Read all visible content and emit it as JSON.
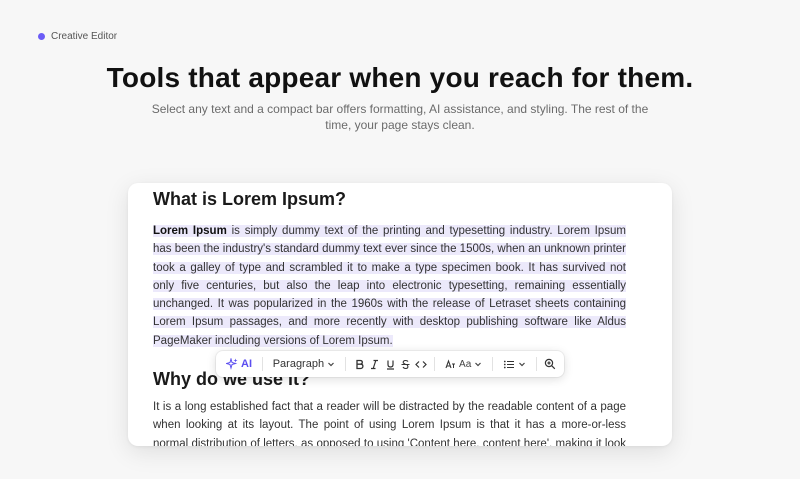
{
  "brand": {
    "label": "Creative Editor",
    "accent": "#6b5cf6"
  },
  "hero": {
    "title": "Tools that appear when you reach for them.",
    "subtitle": "Select any text and a compact bar offers formatting, AI assistance, and styling. The rest of the time, your page stays clean."
  },
  "editor": {
    "heading1": "What is Lorem Ipsum?",
    "para1_bold": "Lorem Ipsum",
    "para1_rest": " is simply dummy text of the printing and typesetting industry. Lorem Ipsum has been the industry's standard dummy text ever since the 1500s, when an unknown printer took a galley of type and scrambled it to make a type specimen book. It has survived not only five centuries, but also the leap into electronic typesetting, remaining essentially unchanged. It was popularized in the 1960s with the release of Letraset sheets containing Lorem Ipsum passages, and more recently with desktop publishing software like Aldus PageMaker including versions of Lorem Ipsum.",
    "heading2": "Why do we use it?",
    "para2": "It is a long established fact that a reader will be distracted by the readable content of a page when looking at its layout. The point of using Lorem Ipsum is that it has a more-or-less normal distribution of letters, as opposed to using 'Content here, content here', making it look like readable English."
  },
  "toolbar": {
    "ai_label": "AI",
    "block_type": "Paragraph",
    "font_label": "Aa",
    "buttons": [
      "bold-icon",
      "italic-icon",
      "underline-icon",
      "strikethrough-icon",
      "code-icon",
      "text-style-icon",
      "list-icon",
      "zoom-icon"
    ],
    "ai_color": "#5b4ef0",
    "highlight_color": "#ece9fb"
  }
}
